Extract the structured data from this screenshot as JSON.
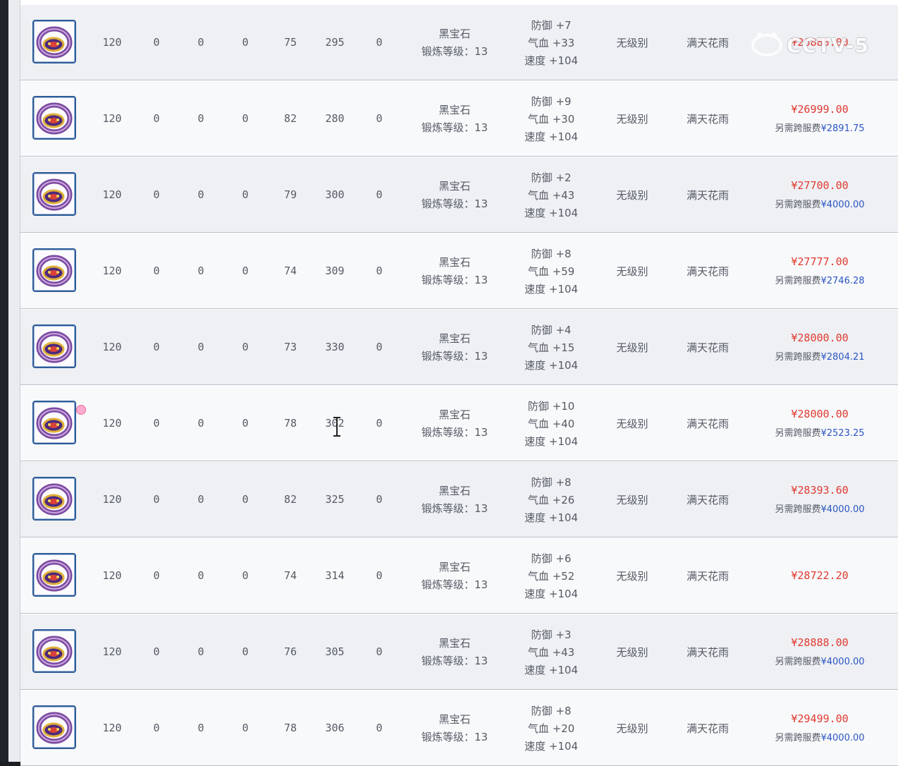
{
  "labels": {
    "gem_name": "黑宝石",
    "forge_prefix": "锻炼等级：",
    "def_label": "防御",
    "hp_label": "气血",
    "speed_label": "速度",
    "level_label": "无级别",
    "effect_label": "满天花雨",
    "fee_prefix": "另需跨服费"
  },
  "watermark_text": "CCTV-5",
  "rows": [
    {
      "level": "120",
      "c1": "0",
      "c2": "0",
      "c3": "0",
      "c4": "75",
      "c5": "295",
      "c6": "0",
      "forge": "13",
      "def": "+7",
      "hp": "+33",
      "speed": "+104",
      "price": "¥26888.00",
      "fee": "",
      "has_gem": false
    },
    {
      "level": "120",
      "c1": "0",
      "c2": "0",
      "c3": "0",
      "c4": "82",
      "c5": "280",
      "c6": "0",
      "forge": "13",
      "def": "+9",
      "hp": "+30",
      "speed": "+104",
      "price": "¥26999.00",
      "fee": "¥2891.75",
      "has_gem": false
    },
    {
      "level": "120",
      "c1": "0",
      "c2": "0",
      "c3": "0",
      "c4": "79",
      "c5": "300",
      "c6": "0",
      "forge": "13",
      "def": "+2",
      "hp": "+43",
      "speed": "+104",
      "price": "¥27700.00",
      "fee": "¥4000.00",
      "has_gem": false
    },
    {
      "level": "120",
      "c1": "0",
      "c2": "0",
      "c3": "0",
      "c4": "74",
      "c5": "309",
      "c6": "0",
      "forge": "13",
      "def": "+8",
      "hp": "+59",
      "speed": "+104",
      "price": "¥27777.00",
      "fee": "¥2746.28",
      "has_gem": false
    },
    {
      "level": "120",
      "c1": "0",
      "c2": "0",
      "c3": "0",
      "c4": "73",
      "c5": "330",
      "c6": "0",
      "forge": "13",
      "def": "+4",
      "hp": "+15",
      "speed": "+104",
      "price": "¥28000.00",
      "fee": "¥2804.21",
      "has_gem": false
    },
    {
      "level": "120",
      "c1": "0",
      "c2": "0",
      "c3": "0",
      "c4": "78",
      "c5": "302",
      "c6": "0",
      "forge": "13",
      "def": "+10",
      "hp": "+40",
      "speed": "+104",
      "price": "¥28000.00",
      "fee": "¥2523.25",
      "has_gem": true
    },
    {
      "level": "120",
      "c1": "0",
      "c2": "0",
      "c3": "0",
      "c4": "82",
      "c5": "325",
      "c6": "0",
      "forge": "13",
      "def": "+8",
      "hp": "+26",
      "speed": "+104",
      "price": "¥28393.60",
      "fee": "¥4000.00",
      "has_gem": false
    },
    {
      "level": "120",
      "c1": "0",
      "c2": "0",
      "c3": "0",
      "c4": "74",
      "c5": "314",
      "c6": "0",
      "forge": "13",
      "def": "+6",
      "hp": "+52",
      "speed": "+104",
      "price": "¥28722.20",
      "fee": "",
      "has_gem": false
    },
    {
      "level": "120",
      "c1": "0",
      "c2": "0",
      "c3": "0",
      "c4": "76",
      "c5": "305",
      "c6": "0",
      "forge": "13",
      "def": "+3",
      "hp": "+43",
      "speed": "+104",
      "price": "¥28888.00",
      "fee": "¥4000.00",
      "has_gem": false
    },
    {
      "level": "120",
      "c1": "0",
      "c2": "0",
      "c3": "0",
      "c4": "78",
      "c5": "306",
      "c6": "0",
      "forge": "13",
      "def": "+8",
      "hp": "+20",
      "speed": "+104",
      "price": "¥29499.00",
      "fee": "¥4000.00",
      "has_gem": false
    }
  ]
}
